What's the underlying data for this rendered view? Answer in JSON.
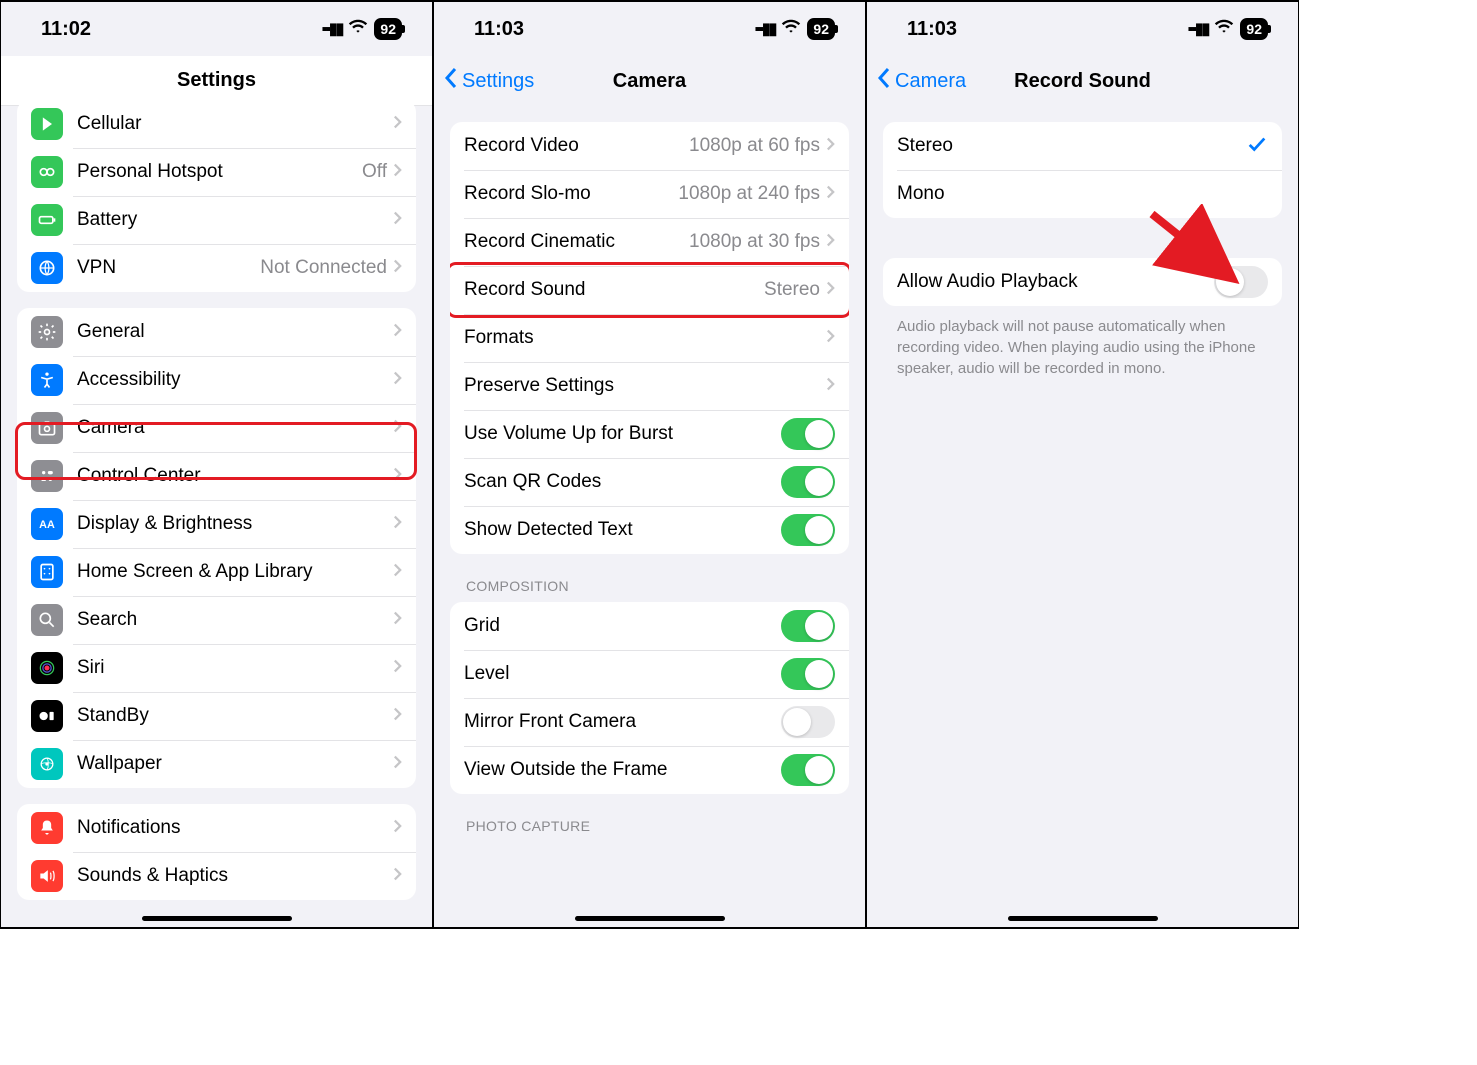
{
  "phone1": {
    "time": "11:02",
    "battery": "92",
    "title": "Settings",
    "groups": [
      {
        "rows": [
          {
            "icon": "cellular",
            "bg": "bg-green",
            "label": "Cellular"
          },
          {
            "icon": "hotspot",
            "bg": "bg-green",
            "label": "Personal Hotspot",
            "value": "Off"
          },
          {
            "icon": "battery",
            "bg": "bg-green",
            "label": "Battery"
          },
          {
            "icon": "vpn",
            "bg": "bg-blue",
            "label": "VPN",
            "value": "Not Connected"
          }
        ]
      },
      {
        "rows": [
          {
            "icon": "gear",
            "bg": "bg-grey",
            "label": "General"
          },
          {
            "icon": "accessibility",
            "bg": "bg-blue",
            "label": "Accessibility"
          },
          {
            "icon": "camera",
            "bg": "bg-grey",
            "label": "Camera",
            "highlight": true
          },
          {
            "icon": "control",
            "bg": "bg-grey",
            "label": "Control Center"
          },
          {
            "icon": "display",
            "bg": "bg-blue",
            "label": "Display & Brightness"
          },
          {
            "icon": "home",
            "bg": "bg-blue",
            "label": "Home Screen & App Library"
          },
          {
            "icon": "search",
            "bg": "bg-grey",
            "label": "Search"
          },
          {
            "icon": "siri",
            "bg": "bg-purple",
            "label": "Siri"
          },
          {
            "icon": "standby",
            "bg": "bg-black",
            "label": "StandBy"
          },
          {
            "icon": "wallpaper",
            "bg": "bg-cyan",
            "label": "Wallpaper"
          }
        ]
      },
      {
        "rows": [
          {
            "icon": "notif",
            "bg": "bg-red",
            "label": "Notifications"
          },
          {
            "icon": "sounds",
            "bg": "bg-red",
            "label": "Sounds & Haptics"
          }
        ]
      }
    ]
  },
  "phone2": {
    "time": "11:03",
    "battery": "92",
    "back": "Settings",
    "title": "Camera",
    "groups": [
      {
        "rows": [
          {
            "label": "Record Video",
            "value": "1080p at 60 fps",
            "chev": true
          },
          {
            "label": "Record Slo-mo",
            "value": "1080p at 240 fps",
            "chev": true
          },
          {
            "label": "Record Cinematic",
            "value": "1080p at 30 fps",
            "chev": true
          },
          {
            "label": "Record Sound",
            "value": "Stereo",
            "chev": true,
            "highlight": true
          },
          {
            "label": "Formats",
            "chev": true
          },
          {
            "label": "Preserve Settings",
            "chev": true
          },
          {
            "label": "Use Volume Up for Burst",
            "toggle": "on"
          },
          {
            "label": "Scan QR Codes",
            "toggle": "on"
          },
          {
            "label": "Show Detected Text",
            "toggle": "on"
          }
        ]
      },
      {
        "header": "COMPOSITION",
        "rows": [
          {
            "label": "Grid",
            "toggle": "on"
          },
          {
            "label": "Level",
            "toggle": "on"
          },
          {
            "label": "Mirror Front Camera",
            "toggle": "off"
          },
          {
            "label": "View Outside the Frame",
            "toggle": "on"
          }
        ]
      },
      {
        "header": "PHOTO CAPTURE",
        "rows": []
      }
    ]
  },
  "phone3": {
    "time": "11:03",
    "battery": "92",
    "back": "Camera",
    "title": "Record Sound",
    "options": [
      {
        "label": "Stereo",
        "checked": true
      },
      {
        "label": "Mono",
        "checked": false
      }
    ],
    "playback": {
      "label": "Allow Audio Playback",
      "toggle": "off"
    },
    "footer": "Audio playback will not pause automatically when recording video. When playing audio using the iPhone speaker, audio will be recorded in mono."
  }
}
